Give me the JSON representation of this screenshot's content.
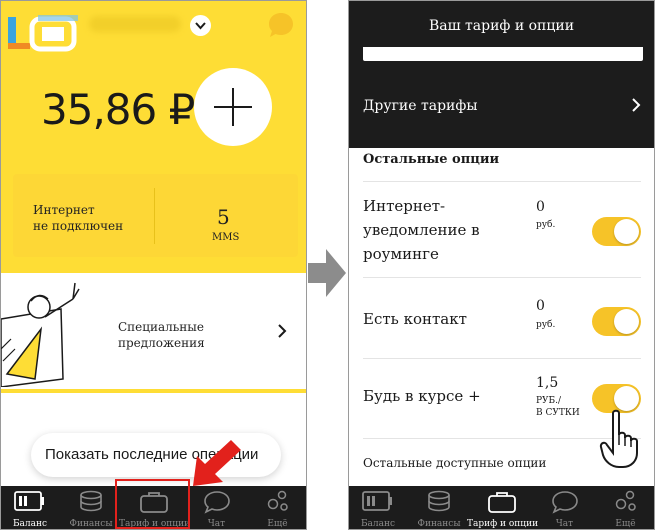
{
  "left": {
    "balance": "35,86 ₽",
    "stats": {
      "internet": "Интернет\nне подключен",
      "sms_count": "5",
      "sms_label": "MMS"
    },
    "offers": {
      "label": "Специальные\nпредложения"
    },
    "recent_button": "Показать последние операции"
  },
  "nav": {
    "items": [
      {
        "label": "Баланс",
        "icon": "battery-icon"
      },
      {
        "label": "Финансы",
        "icon": "coins-icon"
      },
      {
        "label": "Тариф и опции",
        "icon": "briefcase-icon"
      },
      {
        "label": "Чат",
        "icon": "chat-bubble-icon"
      },
      {
        "label": "Ещё",
        "icon": "more-circles-icon"
      }
    ]
  },
  "right": {
    "title": "Ваш тариф и опции",
    "other_tariffs": "Другие тарифы",
    "section_title": "Остальные опции",
    "options": [
      {
        "name": "Интернет-\nуведомление в\nроуминге",
        "price": "0",
        "unit": "руб.",
        "enabled": true
      },
      {
        "name": "Есть контакт",
        "price": "0",
        "unit": "руб.",
        "enabled": true
      },
      {
        "name": "Будь в курсе +",
        "price": "1,5",
        "unit": "РУБ./\nВ СУТКИ",
        "enabled": true
      }
    ],
    "more_options": "Остальные доступные опции"
  },
  "colors": {
    "brand_yellow": "#fedd35",
    "toggle_on": "#f6c328",
    "dark_bar": "#1c1c1c",
    "highlight_red": "#e2211c"
  }
}
